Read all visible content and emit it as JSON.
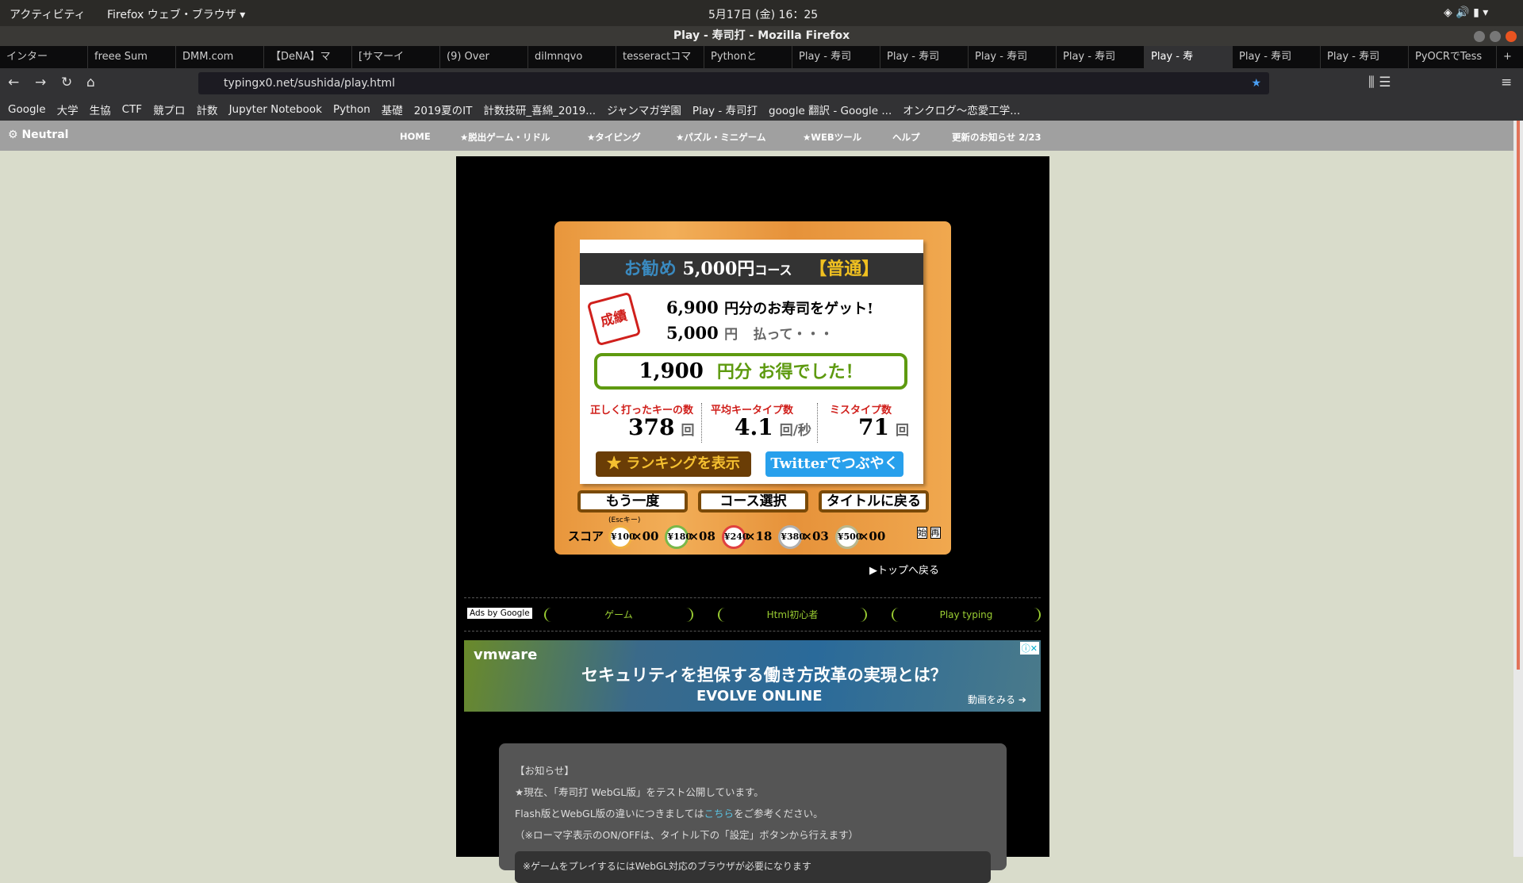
{
  "system": {
    "activities": "アクティビティ",
    "app": "Firefox ウェブ・ブラウザ ▾",
    "clock": "5月17日 (金) 16：25"
  },
  "window": {
    "title": "Play - 寿司打 - Mozilla Firefox"
  },
  "tabs": [
    "インター",
    "freee Sum",
    "DMM.com",
    "【DeNA】マ",
    "[サマーイ",
    "(9) Over",
    "dilmnqvo",
    "tesseractコマ",
    "Pythonと",
    "Play - 寿司",
    "Play - 寿司",
    "Play - 寿司",
    "Play - 寿司",
    "Play - 寿",
    "Play - 寿司",
    "Play - 寿司",
    "PyOCRでTess"
  ],
  "active_tab": 13,
  "address": {
    "url": "typingx0.net/sushida/play.html"
  },
  "bookmarks": [
    "Google",
    "大学",
    "生協",
    "CTF",
    "競プロ",
    "計数",
    "Jupyter Notebook",
    "Python",
    "基礎",
    "2019夏のIT",
    "計数技研_喜綿_2019...",
    "ジャンマガ学園",
    "Play - 寿司打",
    "google 翻訳 - Google ...",
    "オンクログ〜恋愛工学..."
  ],
  "site_nav": {
    "logo": "Neutral",
    "links": [
      "HOME",
      "★脱出ゲーム・リドル",
      "★タイピング",
      "★パズル・ミニゲーム",
      "★WEBツール",
      "ヘルプ",
      "更新のお知らせ 2/23"
    ]
  },
  "result": {
    "course_prefix": "お勧め",
    "course": "5,000円",
    "course_suffix": "コース",
    "difficulty": "【普通】",
    "stamp": "成績",
    "got_value": "6,900",
    "got_text": "円分のお寿司をゲット!",
    "paid_value": "5,000",
    "paid_unit": "円",
    "paid_text": "払って・・・",
    "gain_value": "1,900",
    "gain_text": "円分 お得でした！",
    "stats": [
      {
        "label": "正しく打ったキーの数",
        "value": "378",
        "unit": "回"
      },
      {
        "label": "平均キータイプ数",
        "value": "4.1",
        "unit": "回/秒"
      },
      {
        "label": "ミスタイプ数",
        "value": "71",
        "unit": "回"
      }
    ],
    "ranking_button": "★ ランキングを表示",
    "twitter_button": "Twitterでつぶやく",
    "retry_button": "もう一度",
    "retry_hint": "(Escキー)",
    "course_select_button": "コース選択",
    "title_button": "タイトルに戻る",
    "score_label": "スコア",
    "plates": [
      {
        "price": "¥100",
        "count": "×00",
        "color": "#f0b040"
      },
      {
        "price": "¥180",
        "count": "×08",
        "color": "#7ab84a"
      },
      {
        "price": "¥240",
        "count": "×18",
        "color": "#e04040"
      },
      {
        "price": "¥380",
        "count": "×03",
        "color": "#b0b0b0"
      },
      {
        "price": "¥500",
        "count": "×00",
        "color": "#b8b890"
      }
    ],
    "icons": [
      "始",
      "再"
    ],
    "back_top": "▶トップへ戻る"
  },
  "ads": {
    "ads_by": "Ads by Google",
    "links": [
      "ゲーム",
      "Html初心者",
      "Play typing"
    ],
    "banner": {
      "brand": "vmware",
      "headline": "セキュリティを担保する働き方改革の実現とは？",
      "sub": "EVOLVE ONLINE",
      "cta": "動画をみる ➔"
    }
  },
  "notice": {
    "title": "【お知らせ】",
    "line1": "★現在、「寿司打 WebGL版」をテスト公開しています。",
    "line2_a": "Flash版とWebGL版の違いにつきましては",
    "line2_link": "こちら",
    "line2_b": "をご参考ください。",
    "line3": "（※ローマ字表示のON/OFFは、タイトル下の「設定」ボタンから行えます）",
    "line4": "※ゲームをプレイするにはWebGL対応のブラウザが必要になります"
  }
}
